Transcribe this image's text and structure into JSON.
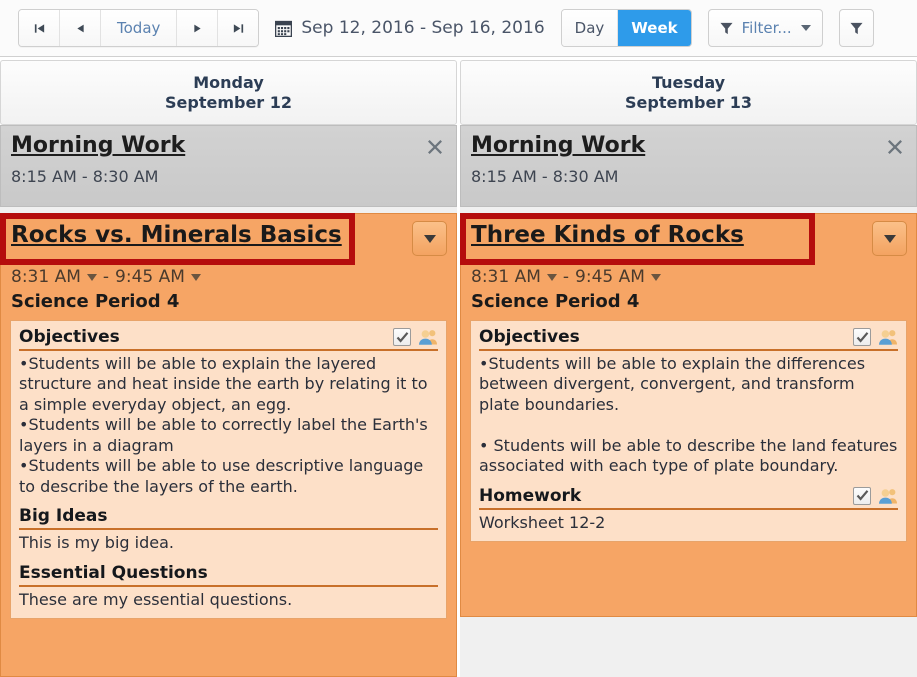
{
  "toolbar": {
    "nav": {
      "first_label": "◀|",
      "prev_label": "◀",
      "today_label": "Today",
      "next_label": "▶",
      "last_label": "|▶"
    },
    "calendar_icon": "calendar-icon",
    "date_range": "Sep 12, 2016 - Sep 16, 2016",
    "views": [
      {
        "label": "Day",
        "active": false
      },
      {
        "label": "Week",
        "active": true
      }
    ],
    "filter_label": "Filter...",
    "filter_icon": "funnel-icon",
    "filter2_icon": "funnel-icon"
  },
  "days": [
    {
      "dow": "Monday",
      "date": "September 12"
    },
    {
      "dow": "Tuesday",
      "date": "September 13"
    }
  ],
  "columns": [
    {
      "morning": {
        "title": "Morning Work",
        "time": "8:15 AM - 8:30 AM",
        "close_icon": "close-icon"
      },
      "lesson": {
        "title": "Rocks vs. Minerals Basics",
        "highlighted": true,
        "start_time": "8:31 AM",
        "dash": "-",
        "end_time": "9:45 AM",
        "period": "Science Period 4",
        "sections": [
          {
            "label": "Objectives",
            "checked": true,
            "body": "•Students will be able to explain the layered structure and heat inside the earth by relating it to a simple everyday object, an egg.\n•Students will be able to correctly label the Earth's layers in a diagram\n•Students will be able to use descriptive language to describe the layers of the earth."
          },
          {
            "label": "Big Ideas",
            "checked": false,
            "body": "This is my big idea."
          },
          {
            "label": "Essential Questions",
            "checked": false,
            "body": "These are my essential questions."
          }
        ]
      }
    },
    {
      "morning": {
        "title": "Morning Work",
        "time": "8:15 AM - 8:30 AM",
        "close_icon": "close-icon"
      },
      "lesson": {
        "title": "Three Kinds of Rocks",
        "highlighted": true,
        "start_time": "8:31 AM",
        "dash": "-",
        "end_time": "9:45 AM",
        "period": "Science Period 4",
        "sections": [
          {
            "label": "Objectives",
            "checked": true,
            "body": "•Students will be able to explain the differences between divergent, convergent, and transform plate boundaries.\n\n• Students will be able to describe the land features associated with each type of plate boundary."
          },
          {
            "label": "Homework",
            "checked": true,
            "body": "Worksheet 12-2"
          }
        ]
      }
    }
  ],
  "colors": {
    "accent_blue": "#2e9bea",
    "orange_card": "#f6a565",
    "panel_bg": "#fde0c8",
    "highlight_red": "#b50d0d",
    "gray_event": "#cdcdcd"
  }
}
